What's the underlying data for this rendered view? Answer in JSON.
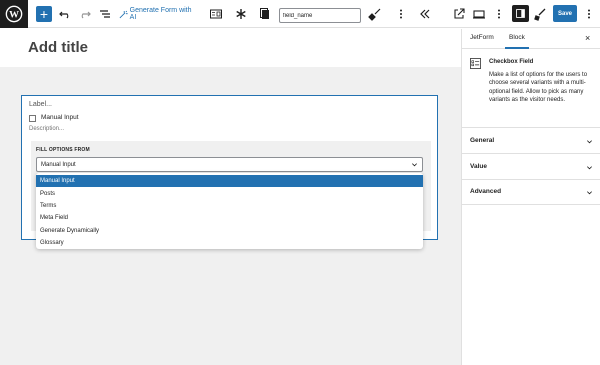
{
  "toolbar": {
    "generate_form_label": "Generate Form with AI",
    "field_name_value": "field_name",
    "save_label": "Save"
  },
  "editor": {
    "title_placeholder": "Add title"
  },
  "block": {
    "label_placeholder": "Label...",
    "checkbox_option": "Manual Input",
    "description_placeholder": "Description...",
    "fill_options_label": "FILL OPTIONS FROM",
    "selected_value": "Manual Input",
    "options": [
      "Manual Input",
      "Posts",
      "Terms",
      "Meta Field",
      "Generate Dynamically",
      "Glossary"
    ]
  },
  "sidebar": {
    "tabs": [
      "JetForm",
      "Block"
    ],
    "active_tab": "Block",
    "block_name": "Checkbox Field",
    "block_description": "Make a list of options for the users to choose several variants with a multi-optional field. Allow to pick as many variants as the visitor needs.",
    "panels": [
      "General",
      "Value",
      "Advanced"
    ]
  },
  "colors": {
    "accent": "#2271b1",
    "dark": "#1e1e1e"
  }
}
